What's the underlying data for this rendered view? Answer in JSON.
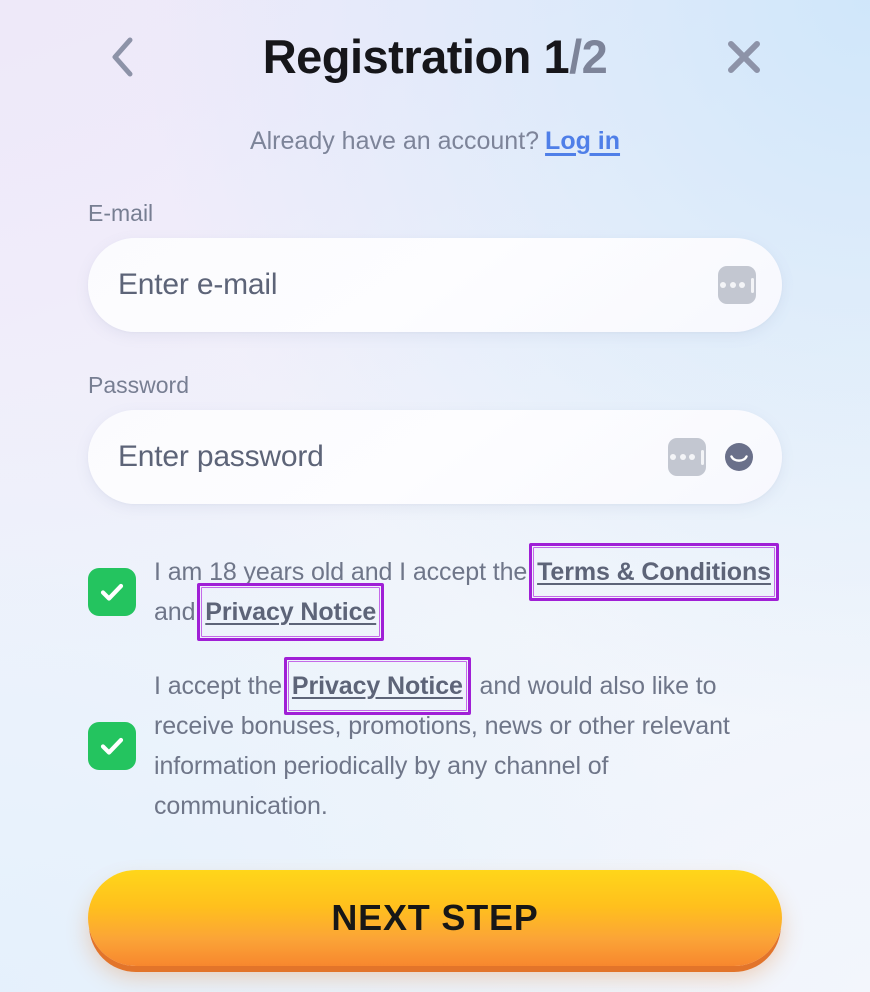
{
  "header": {
    "back_icon": "chevron-left-icon",
    "close_icon": "close-icon",
    "title_main": "Registration 1",
    "title_total": "/2"
  },
  "account": {
    "prompt": "Already have an account?",
    "login_label": "Log in"
  },
  "form": {
    "email": {
      "label": "E-mail",
      "placeholder": "Enter e-mail",
      "value": "",
      "autofill_icon": "password-manager-dots-icon"
    },
    "password": {
      "label": "Password",
      "placeholder": "Enter password",
      "value": "",
      "autofill_icon": "password-manager-dots-icon",
      "reveal_icon": "eye-icon"
    }
  },
  "consents": [
    {
      "checked": true,
      "text_before": "I am 18 years old and I accept the",
      "link1": "Terms & Conditions",
      "text_middle": "and",
      "link2": "Privacy Notice",
      "text_after": ""
    },
    {
      "checked": true,
      "text_before": "I accept the",
      "link1": "Privacy Notice",
      "text_after": ", and would also like to receive bonuses, promotions, news or other relevant information periodically by any channel of communication."
    }
  ],
  "cta": {
    "label": "NEXT STEP"
  },
  "colors": {
    "accent_green": "#24c45f",
    "cta_gradient_top": "#ffd61a",
    "cta_gradient_bottom": "#f7872e",
    "cta_shadow": "#e2742a",
    "link_blue": "#4f7fe8",
    "highlight_purple": "#a01fd6",
    "text_muted": "#7d8499"
  }
}
